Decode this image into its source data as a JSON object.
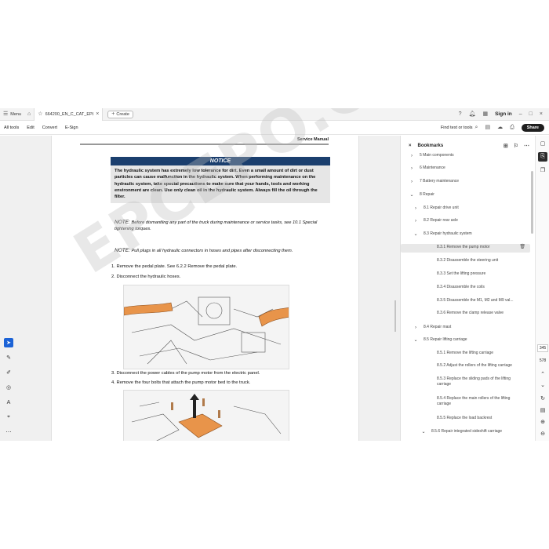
{
  "tabbar": {
    "menu_label": "Menu",
    "doc_tab_name": "664200_EN_C_CAT_EPL",
    "create_label": "Create",
    "signin_label": "Sign in"
  },
  "toolbar": {
    "items": [
      "All tools",
      "Edit",
      "Convert",
      "E-Sign"
    ],
    "find_label": "Find text or tools",
    "share_label": "Share"
  },
  "document": {
    "header": "Service Manual",
    "notice_title": "NOTICE",
    "notice_body": "The hydraulic system has extremely low tolerance for dirt. Even a small amount of dirt or dust particles can cause malfunction in the hydraulic system. When performing maintenance on the hydraulic system, take special precautions to make sure that your hands, tools and working environment are clean. Use only clean oil in the hydraulic system. Always fill the oil through the filter.",
    "note1_prefix": "NOTE:",
    "note1_text": "Before dismantling any part of the truck during maintenance or service tasks, see 10.1 Special tightening torques.",
    "note2_prefix": "NOTE:",
    "note2_text": "Pull plugs in all hydraulic connectors in hoses and pipes after disconnecting them.",
    "steps": [
      "1. Remove the pedal plate. See 6.2.2 Remove the pedal plate.",
      "2. Disconnect the hydraulic hoses.",
      "3. Disconnect the power cables of the pump motor from the electric panel.",
      "4. Remove the four bolts that attach the pump motor bed to the truck."
    ],
    "watermark": "EPCEPO.COM"
  },
  "bookmarks": {
    "title": "Bookmarks",
    "items": [
      {
        "label": "5 Main components",
        "chev": "›"
      },
      {
        "label": "6 Maintenance",
        "chev": "›"
      },
      {
        "label": "7 Battery maintenance",
        "chev": "›"
      },
      {
        "label": "8 Repair",
        "chev": "⌄"
      },
      {
        "label": "8.1 Repair drive unit",
        "chev": "›"
      },
      {
        "label": "8.2 Repair rear axle",
        "chev": "›"
      },
      {
        "label": "8.3 Repair hydraulic system",
        "chev": "⌄"
      },
      {
        "label": "8.3.1 Remove the pump motor",
        "chev": ""
      },
      {
        "label": "8.3.2 Disassemble the steering unit",
        "chev": ""
      },
      {
        "label": "8.3.3 Set the lifting pressure",
        "chev": ""
      },
      {
        "label": "8.3.4 Disassemble the coils",
        "chev": ""
      },
      {
        "label": "8.3.5 Disassemble the M1, M2 and M9 val...",
        "chev": ""
      },
      {
        "label": "8.3.6 Remove the clamp release valve",
        "chev": ""
      },
      {
        "label": "8.4 Repair mast",
        "chev": "›"
      },
      {
        "label": "8.5 Repair lifting carriage",
        "chev": "⌄"
      },
      {
        "label": "8.5.1 Remove the lifting carriage",
        "chev": ""
      },
      {
        "label": "8.5.2 Adjust the rollers of the lifting carriage",
        "chev": ""
      },
      {
        "label": "8.5.3 Replace the sliding pads of the lifting carriage",
        "chev": ""
      },
      {
        "label": "8.5.4 Replace the main rollers of the lifting carriage",
        "chev": ""
      },
      {
        "label": "8.5.5 Replace the load backrest",
        "chev": ""
      },
      {
        "label": "8.5.6 Repair integrated sideshift carriage",
        "chev": "⌄"
      }
    ]
  },
  "rail": {
    "current_page": "345",
    "total_pages": "578"
  }
}
